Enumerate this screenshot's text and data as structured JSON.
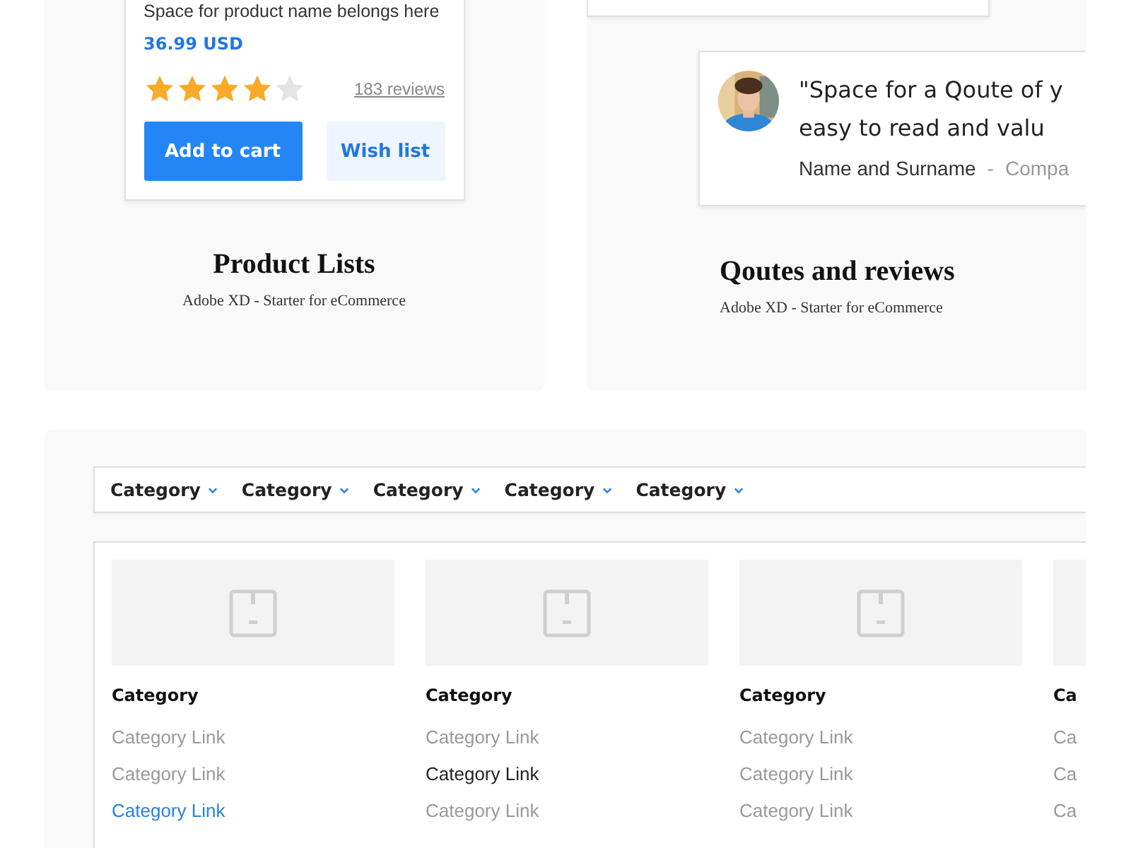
{
  "product_panel": {
    "product_card": {
      "name": "Space for product name belongs here",
      "price": "36.99 USD",
      "stars": 4,
      "reviews": "183 reviews",
      "primary_button": "Add to cart",
      "secondary_button": "Wish list"
    },
    "title": "Product Lists",
    "subtitle": "Adobe XD - Starter for eCommerce"
  },
  "reviews_panel": {
    "quote_card": {
      "avatar": {
        "kind": "picture"
      },
      "quote_lines": [
        "\"Space for a Qoute of y",
        "easy to read and valu"
      ],
      "author": "Name and Surname",
      "separator": "-",
      "company": "Compa"
    },
    "title": "Qoutes and reviews",
    "subtitle": "Adobe XD - Starter for eCommerce"
  },
  "menu_panel": {
    "nav": [
      "Category",
      "Category",
      "Category",
      "Category",
      "Category"
    ],
    "columns": [
      {
        "heading": "Category",
        "links": [
          {
            "label": "Category Link",
            "selected": false,
            "hovered": false
          },
          {
            "label": "Category Link",
            "selected": false,
            "hovered": false
          },
          {
            "label": "Category Link",
            "selected": true,
            "hovered": false
          }
        ]
      },
      {
        "heading": "Category",
        "links": [
          {
            "label": "Category Link",
            "selected": false,
            "hovered": false
          },
          {
            "label": "Category Link",
            "selected": false,
            "hovered": true
          },
          {
            "label": "Category Link",
            "selected": false,
            "hovered": false
          }
        ]
      },
      {
        "heading": "Category",
        "links": [
          {
            "label": "Category Link",
            "selected": false,
            "hovered": false
          },
          {
            "label": "Category Link",
            "selected": false,
            "hovered": false
          },
          {
            "label": "Category Link",
            "selected": false,
            "hovered": false
          }
        ]
      },
      {
        "heading": "Ca",
        "icon_in_view": false,
        "links": [
          {
            "label": "Ca",
            "selected": false,
            "hovered": false
          },
          {
            "label": "Ca",
            "selected": false,
            "hovered": false
          },
          {
            "label": "Ca",
            "selected": false,
            "hovered": false
          }
        ]
      }
    ]
  }
}
